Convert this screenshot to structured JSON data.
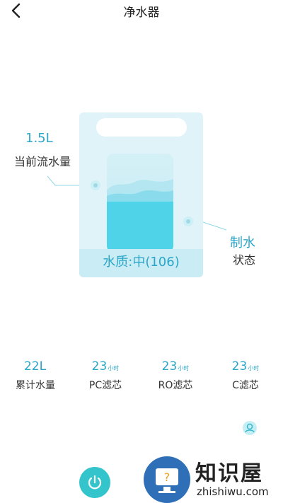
{
  "header": {
    "title": "净水器"
  },
  "left_info": {
    "value": "1.5L",
    "label": "当前流水量"
  },
  "right_info": {
    "value": "制水",
    "label": "状态"
  },
  "card": {
    "quality_text": "水质:中(106)"
  },
  "stats": [
    {
      "value": "22L",
      "unit": "",
      "label": "累计水量"
    },
    {
      "value": "23",
      "unit": "小时",
      "label": "PC滤芯"
    },
    {
      "value": "23",
      "unit": "小时",
      "label": "RO滤芯"
    },
    {
      "value": "23",
      "unit": "小时",
      "label": "C滤芯"
    }
  ],
  "watermark": {
    "name": "知识屋",
    "domain": "zhishiwu.com"
  },
  "colors": {
    "accent": "#2ba6c9",
    "power": "#34c4cc",
    "card_bg": "#dff3f8"
  },
  "icons": {
    "back": "back-icon",
    "power": "power-icon",
    "user": "user-icon"
  }
}
